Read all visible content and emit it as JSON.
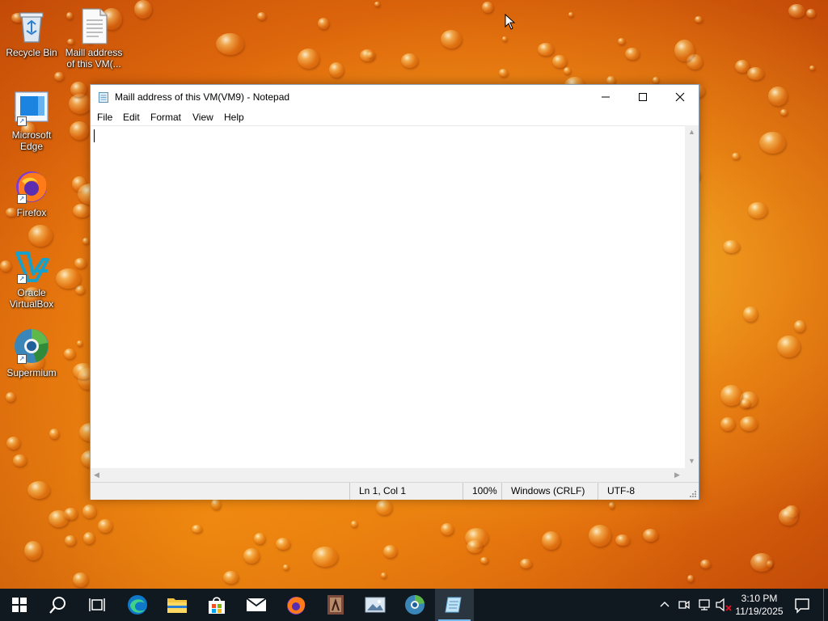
{
  "desktop": {
    "icons": [
      {
        "label": "Recycle Bin",
        "icon": "recycle-bin-icon"
      },
      {
        "label": "Maill address of this VM(...",
        "icon": "text-file-icon"
      },
      {
        "label": "Microsoft Edge",
        "icon": "edge-icon"
      },
      {
        "label": "Firefox",
        "icon": "firefox-icon"
      },
      {
        "label": "Oracle VirtualBox",
        "icon": "virtualbox-icon"
      },
      {
        "label": "Supermium",
        "icon": "supermium-icon"
      }
    ]
  },
  "notepad": {
    "title": "Maill address of this VM(VM9) - Notepad",
    "menu": [
      "File",
      "Edit",
      "Format",
      "View",
      "Help"
    ],
    "content": "",
    "status": {
      "position": "Ln 1, Col 1",
      "zoom": "100%",
      "line_ending": "Windows (CRLF)",
      "encoding": "UTF-8"
    }
  },
  "taskbar": {
    "apps": [
      "start-icon",
      "search-icon",
      "task-view-icon",
      "edge-icon",
      "file-explorer-icon",
      "store-icon",
      "mail-icon",
      "firefox-icon",
      "app-icon",
      "photos-icon",
      "supermium-icon",
      "notepad-icon"
    ],
    "active_app": "notepad-icon",
    "clock": {
      "time": "3:10 PM",
      "date": "11/19/2025"
    }
  },
  "colors": {
    "taskbar": "#101820",
    "accent": "#76b9ed",
    "desktop_base": "#e06a0c"
  }
}
